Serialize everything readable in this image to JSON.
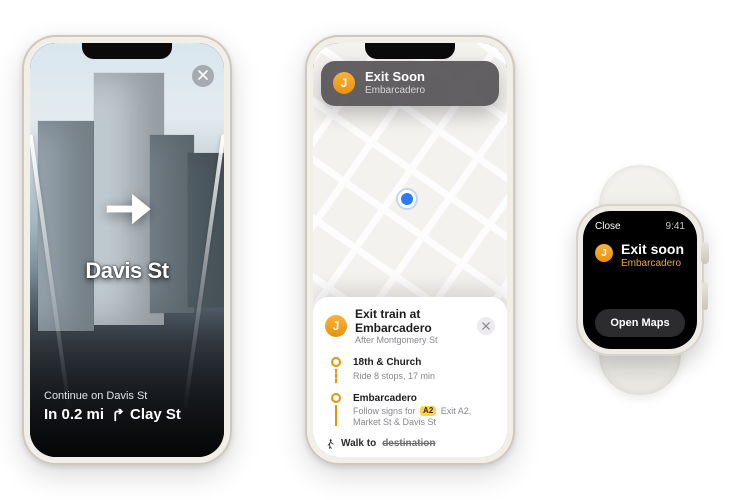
{
  "phone_a": {
    "close_label": "Close AR",
    "arrow_name": "right",
    "street": "Davis St",
    "continue_line": "Continue on Davis St",
    "next_dist": "In 0.2 mi",
    "next_turn_icon": "turn-right",
    "next_street": "Clay St"
  },
  "phone_b": {
    "toast": {
      "badge": "J",
      "title": "Exit Soon",
      "subtitle": "Embarcadero"
    },
    "card": {
      "badge": "J",
      "title": "Exit train at Embarcadero",
      "subtitle": "After Montgomery St",
      "step1_title": "18th & Church",
      "ride_info": "Ride 8 stops, 17 min",
      "step2_title": "Embarcadero",
      "step2_desc_prefix": "Follow signs for",
      "step2_tag": "A2",
      "step2_desc_suffix": "Exit A2, Market St & Davis St",
      "walk_label": "Walk to",
      "walk_dest": "destination"
    }
  },
  "watch": {
    "close": "Close",
    "time": "9:41",
    "badge": "J",
    "title": "Exit soon",
    "subtitle": "Embarcadero",
    "button": "Open Maps"
  }
}
